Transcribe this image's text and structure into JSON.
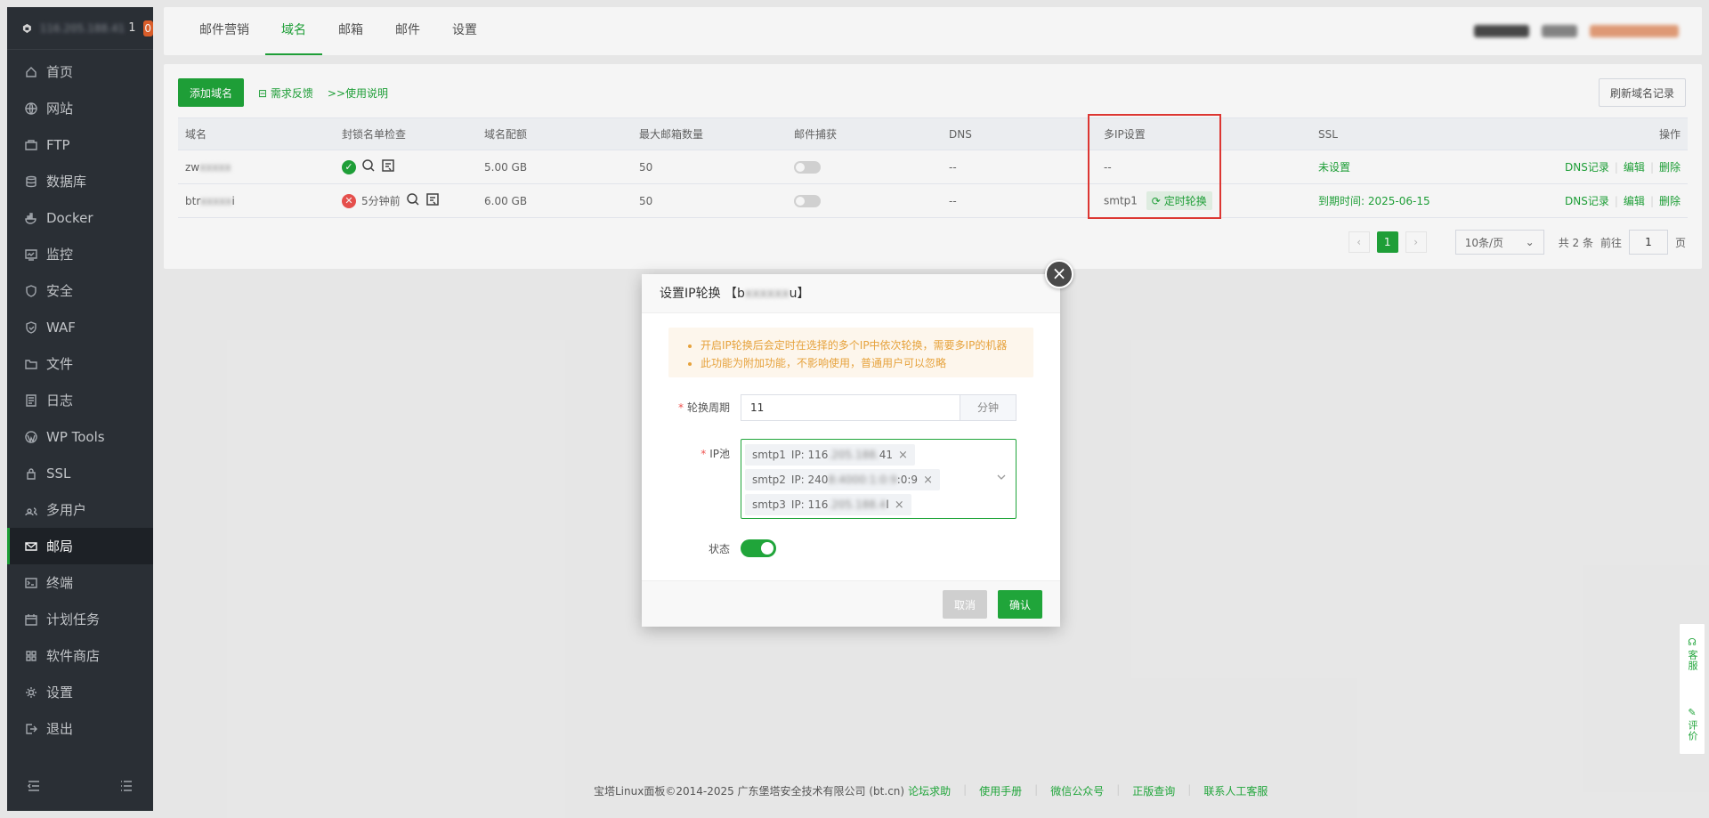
{
  "sidebar": {
    "ip": "116.205.188.41",
    "ip_suffix": "1",
    "badge": "0",
    "items": [
      {
        "label": "首页",
        "icon": "home-icon"
      },
      {
        "label": "网站",
        "icon": "globe-icon"
      },
      {
        "label": "FTP",
        "icon": "ftp-icon"
      },
      {
        "label": "数据库",
        "icon": "database-icon"
      },
      {
        "label": "Docker",
        "icon": "docker-icon"
      },
      {
        "label": "监控",
        "icon": "monitor-icon"
      },
      {
        "label": "安全",
        "icon": "shield-icon"
      },
      {
        "label": "WAF",
        "icon": "waf-icon"
      },
      {
        "label": "文件",
        "icon": "folder-icon"
      },
      {
        "label": "日志",
        "icon": "log-icon"
      },
      {
        "label": "WP Tools",
        "icon": "wordpress-icon"
      },
      {
        "label": "SSL",
        "icon": "ssl-icon"
      },
      {
        "label": "多用户",
        "icon": "users-icon"
      },
      {
        "label": "邮局",
        "icon": "mail-icon"
      },
      {
        "label": "终端",
        "icon": "terminal-icon"
      },
      {
        "label": "计划任务",
        "icon": "calendar-icon"
      },
      {
        "label": "软件商店",
        "icon": "store-icon"
      },
      {
        "label": "设置",
        "icon": "gear-icon"
      },
      {
        "label": "退出",
        "icon": "logout-icon"
      }
    ]
  },
  "tabs": [
    "邮件营销",
    "域名",
    "邮箱",
    "邮件",
    "设置"
  ],
  "toolbar": {
    "add_domain": "添加域名",
    "feedback": "需求反馈",
    "usage": ">>使用说明",
    "refresh": "刷新域名记录"
  },
  "table": {
    "headers": [
      "域名",
      "封锁名单检查",
      "域名配额",
      "最大邮箱数量",
      "邮件捕获",
      "DNS",
      "多IP设置",
      "SSL",
      "操作"
    ],
    "rows": [
      {
        "domain_visible": "zw",
        "domain_hidden": "xxxxx",
        "blacklist_time": "",
        "quota": "5.00 GB",
        "max_mailboxes": "50",
        "dns": "--",
        "multi_ip": "--",
        "multi_ip_tag": "",
        "ssl": "未设置"
      },
      {
        "domain_visible": "btr",
        "domain_hidden": "xxxxx",
        "domain_end": "i",
        "blacklist_time": "5分钟前",
        "quota": "6.00 GB",
        "max_mailboxes": "50",
        "dns": "--",
        "multi_ip": "smtp1",
        "multi_ip_tag": "定时轮换",
        "ssl": "到期时间: 2025-06-15"
      }
    ],
    "ops": [
      "DNS记录",
      "编辑",
      "删除"
    ]
  },
  "pager": {
    "current": "1",
    "per_page": "10条/页",
    "total": "共 2 条",
    "goto_label": "前往",
    "goto_value": "1",
    "page_unit": "页"
  },
  "modal": {
    "title_prefix": "设置IP轮换 【b",
    "title_hidden": "xxxxxx",
    "title_suffix": "u】",
    "notices": [
      "开启IP轮换后会定时在选择的多个IP中依次轮换，需要多IP的机器",
      "此功能为附加功能，不影响使用，普通用户可以忽略"
    ],
    "period_label": "轮换周期",
    "period_value": "11",
    "period_unit": "分钟",
    "ip_pool_label": "IP池",
    "ip_tags": [
      {
        "name": "smtp1",
        "ip_prefix": "IP: 116",
        "ip_hidden": ".205.188.",
        "ip_suffix": "41"
      },
      {
        "name": "smtp2",
        "ip_prefix": "IP: 240",
        "ip_hidden": "8:4000:1:0:9",
        "ip_suffix": ":0:9"
      },
      {
        "name": "smtp3",
        "ip_prefix": "IP: 116",
        "ip_hidden": ".205.188.4",
        "ip_suffix": "l"
      }
    ],
    "status_label": "状态",
    "status_on": true,
    "cancel": "取消",
    "confirm": "确认"
  },
  "footer": {
    "copyright": "宝塔Linux面板©2014-2025 广东堡塔安全技术有限公司 (bt.cn)",
    "links": [
      "论坛求助",
      "使用手册",
      "微信公众号",
      "正版查询",
      "联系人工客服"
    ]
  },
  "float": {
    "support": "客服",
    "rate": "评价"
  },
  "colors": {
    "accent": "#20a53a",
    "sidebar_bg": "#2c3138",
    "badge": "#e2612c",
    "highlight_box": "#e53935"
  }
}
